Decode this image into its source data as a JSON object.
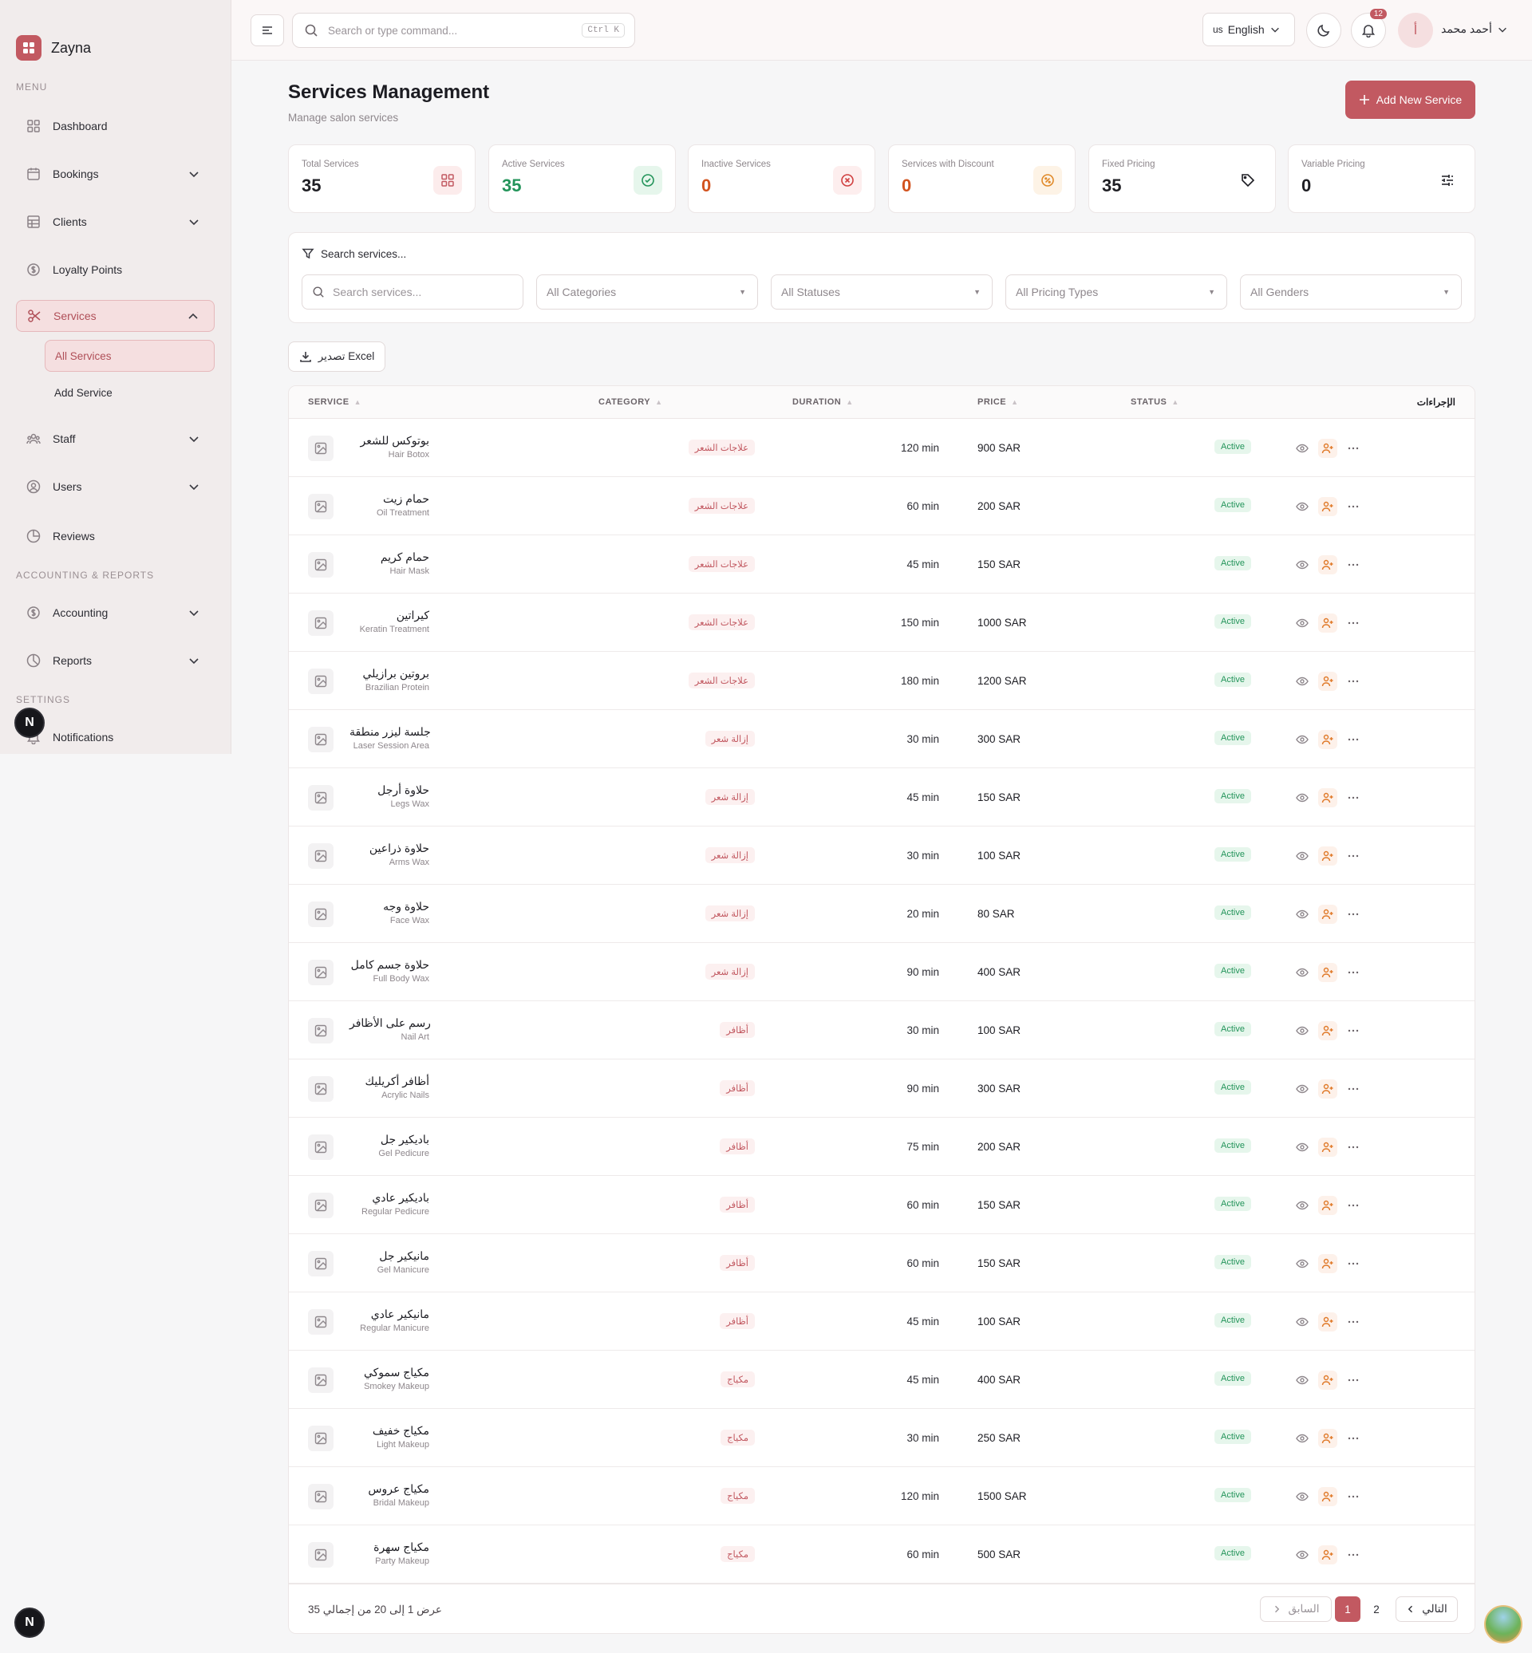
{
  "brand": {
    "name": "Zayna"
  },
  "sidebar": {
    "menu_label": "MENU",
    "items": [
      {
        "label": "Dashboard"
      },
      {
        "label": "Bookings"
      },
      {
        "label": "Clients"
      },
      {
        "label": "Loyalty Points"
      },
      {
        "label": "Services"
      },
      {
        "label": "Staff"
      },
      {
        "label": "Users"
      },
      {
        "label": "Reviews"
      }
    ],
    "sub_items": [
      {
        "label": "All Services"
      },
      {
        "label": "Add Service"
      }
    ],
    "acc_label": "ACCOUNTING & REPORTS",
    "acc_items": [
      {
        "label": "Accounting"
      },
      {
        "label": "Reports"
      }
    ],
    "settings_label": "SETTINGS",
    "settings_items": [
      {
        "label": "Notifications"
      }
    ],
    "badge": "N"
  },
  "topbar": {
    "search_placeholder": "Search or type command...",
    "shortcut": "Ctrl K",
    "language_flag": "us",
    "language": "English",
    "notif_count": "12",
    "avatar_letter": "أ",
    "user_name": "أحمد محمد"
  },
  "header": {
    "title": "Services Management",
    "subtitle": "Manage salon services",
    "add_button": "Add New Service"
  },
  "stats": [
    {
      "label": "Total Services",
      "value": "35",
      "color": "#1c1c22"
    },
    {
      "label": "Active Services",
      "value": "35",
      "color": "#23945a"
    },
    {
      "label": "Inactive Services",
      "value": "0",
      "color": "#d2531f"
    },
    {
      "label": "Services with Discount",
      "value": "0",
      "color": "#d2531f"
    },
    {
      "label": "Fixed Pricing",
      "value": "35",
      "color": "#1c1c22"
    },
    {
      "label": "Variable Pricing",
      "value": "0",
      "color": "#1c1c22"
    }
  ],
  "filters": {
    "title": "Search services...",
    "search_placeholder": "Search services...",
    "categories": "All Categories",
    "statuses": "All Statuses",
    "pricing": "All Pricing Types",
    "genders": "All Genders"
  },
  "export_label": "تصدير Excel",
  "table": {
    "headers": {
      "service": "SERVICE",
      "category": "CATEGORY",
      "duration": "DURATION",
      "price": "PRICE",
      "status": "STATUS",
      "actions": "الإجراءات"
    },
    "rows": [
      {
        "ar": "بوتوكس للشعر",
        "en": "Hair Botox",
        "category": "علاجات الشعر",
        "duration": "120 min",
        "price": "900 SAR",
        "status": "Active"
      },
      {
        "ar": "حمام زيت",
        "en": "Oil Treatment",
        "category": "علاجات الشعر",
        "duration": "60 min",
        "price": "200 SAR",
        "status": "Active"
      },
      {
        "ar": "حمام كريم",
        "en": "Hair Mask",
        "category": "علاجات الشعر",
        "duration": "45 min",
        "price": "150 SAR",
        "status": "Active"
      },
      {
        "ar": "كيراتين",
        "en": "Keratin Treatment",
        "category": "علاجات الشعر",
        "duration": "150 min",
        "price": "1000 SAR",
        "status": "Active"
      },
      {
        "ar": "بروتين برازيلي",
        "en": "Brazilian Protein",
        "category": "علاجات الشعر",
        "duration": "180 min",
        "price": "1200 SAR",
        "status": "Active"
      },
      {
        "ar": "جلسة ليزر منطقة",
        "en": "Laser Session Area",
        "category": "إزالة شعر",
        "duration": "30 min",
        "price": "300 SAR",
        "status": "Active"
      },
      {
        "ar": "حلاوة أرجل",
        "en": "Legs Wax",
        "category": "إزالة شعر",
        "duration": "45 min",
        "price": "150 SAR",
        "status": "Active"
      },
      {
        "ar": "حلاوة ذراعين",
        "en": "Arms Wax",
        "category": "إزالة شعر",
        "duration": "30 min",
        "price": "100 SAR",
        "status": "Active"
      },
      {
        "ar": "حلاوة وجه",
        "en": "Face Wax",
        "category": "إزالة شعر",
        "duration": "20 min",
        "price": "80 SAR",
        "status": "Active"
      },
      {
        "ar": "حلاوة جسم كامل",
        "en": "Full Body Wax",
        "category": "إزالة شعر",
        "duration": "90 min",
        "price": "400 SAR",
        "status": "Active"
      },
      {
        "ar": "رسم على الأظافر",
        "en": "Nail Art",
        "category": "أظافر",
        "duration": "30 min",
        "price": "100 SAR",
        "status": "Active"
      },
      {
        "ar": "أظافر أكريليك",
        "en": "Acrylic Nails",
        "category": "أظافر",
        "duration": "90 min",
        "price": "300 SAR",
        "status": "Active"
      },
      {
        "ar": "باديكير جل",
        "en": "Gel Pedicure",
        "category": "أظافر",
        "duration": "75 min",
        "price": "200 SAR",
        "status": "Active"
      },
      {
        "ar": "باديكير عادي",
        "en": "Regular Pedicure",
        "category": "أظافر",
        "duration": "60 min",
        "price": "150 SAR",
        "status": "Active"
      },
      {
        "ar": "مانيكير جل",
        "en": "Gel Manicure",
        "category": "أظافر",
        "duration": "60 min",
        "price": "150 SAR",
        "status": "Active"
      },
      {
        "ar": "مانيكير عادي",
        "en": "Regular Manicure",
        "category": "أظافر",
        "duration": "45 min",
        "price": "100 SAR",
        "status": "Active"
      },
      {
        "ar": "مكياج سموكي",
        "en": "Smokey Makeup",
        "category": "مكياج",
        "duration": "45 min",
        "price": "400 SAR",
        "status": "Active"
      },
      {
        "ar": "مكياج خفيف",
        "en": "Light Makeup",
        "category": "مكياج",
        "duration": "30 min",
        "price": "250 SAR",
        "status": "Active"
      },
      {
        "ar": "مكياج عروس",
        "en": "Bridal Makeup",
        "category": "مكياج",
        "duration": "120 min",
        "price": "1500 SAR",
        "status": "Active"
      },
      {
        "ar": "مكياج سهرة",
        "en": "Party Makeup",
        "category": "مكياج",
        "duration": "60 min",
        "price": "500 SAR",
        "status": "Active"
      }
    ]
  },
  "pagination": {
    "summary": "عرض 1 إلى 20 من إجمالي 35",
    "prev": "السابق",
    "pages": [
      "1",
      "2"
    ],
    "next": "التالي"
  }
}
